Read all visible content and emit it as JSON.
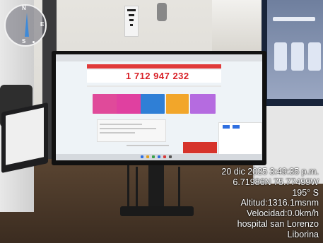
{
  "photo": {
    "screen_phone_number": "1 712 947 232",
    "compass_letters": {
      "north": "N",
      "east": "E",
      "south": "S"
    }
  },
  "overlay": {
    "datetime": "20 dic 2025 3:49:35 p.m.",
    "coordinates": "6.71986N 75.77499W",
    "heading": "195° S",
    "altitude": "Altitud:1316.1msnm",
    "speed": "Velocidad:0.0km/h",
    "location_line1": "hospital san Lorenzo",
    "location_line2": "Liborina"
  },
  "colors": {
    "accent_red": "#d81f26",
    "compass_blue": "#3f8ad8",
    "tile_colors": [
      "#e04a9a",
      "#e040a0",
      "#2f7fd6",
      "#f2a62a",
      "#b56be0"
    ]
  }
}
